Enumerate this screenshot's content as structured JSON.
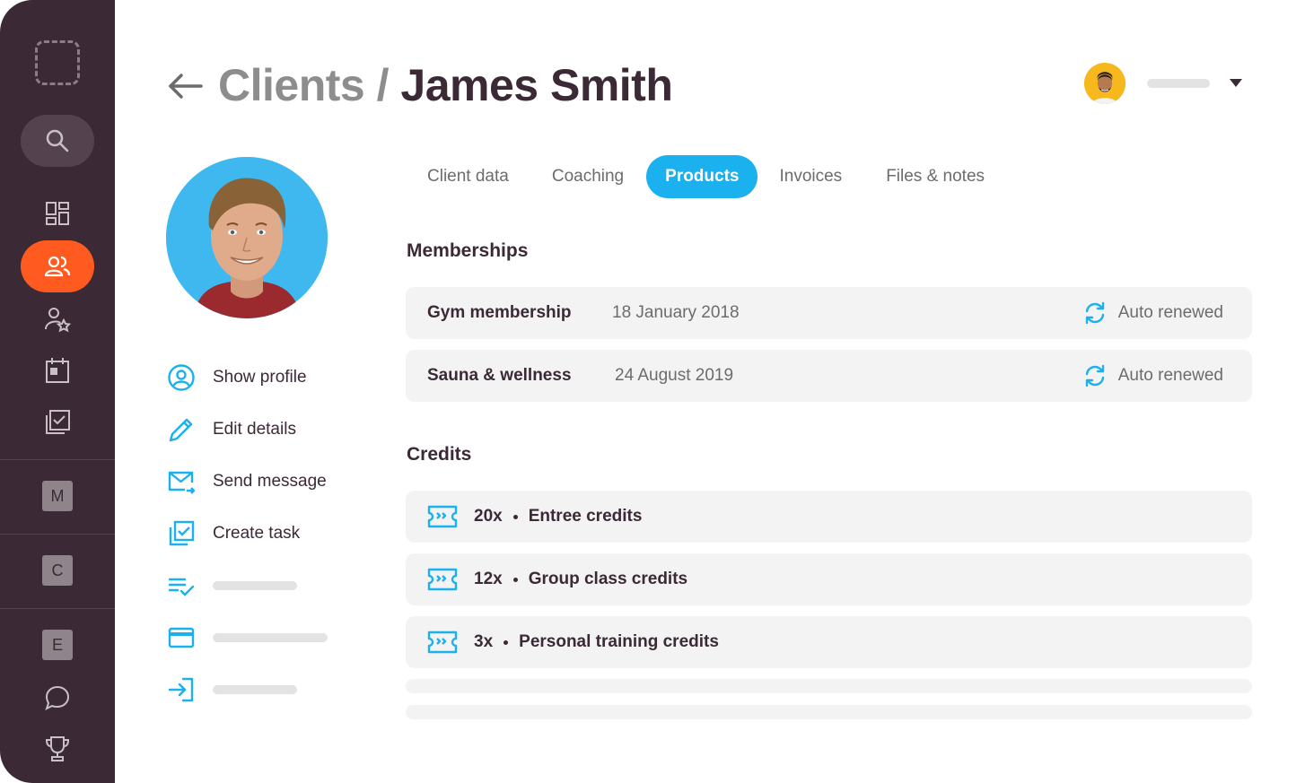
{
  "sidebar": {
    "icons": [
      "logo-placeholder-icon",
      "search-icon",
      "dashboard-icon",
      "clients-icon",
      "user-star-icon",
      "calendar-icon",
      "tasks-icon",
      "chat-icon",
      "trophy-icon"
    ],
    "letters": [
      "M",
      "C",
      "E"
    ],
    "active_color": "#ff5a1f",
    "background_color": "#3b2a36"
  },
  "header": {
    "breadcrumb": "Clients",
    "separator": " / ",
    "client_name": "James Smith"
  },
  "tabs": [
    {
      "label": "Client data",
      "active": false
    },
    {
      "label": "Coaching",
      "active": false
    },
    {
      "label": "Products",
      "active": true
    },
    {
      "label": "Invoices",
      "active": false
    },
    {
      "label": "Files & notes",
      "active": false
    }
  ],
  "actions": [
    {
      "label": "Show profile",
      "icon": "user-circle-icon"
    },
    {
      "label": "Edit details",
      "icon": "pencil-icon"
    },
    {
      "label": "Send message",
      "icon": "mail-send-icon"
    },
    {
      "label": "Create task",
      "icon": "task-check-icon"
    }
  ],
  "memberships": {
    "title": "Memberships",
    "items": [
      {
        "name": "Gym membership",
        "date": "18 January 2018",
        "status": "Auto renewed"
      },
      {
        "name": "Sauna & wellness",
        "date": "24 August 2019",
        "status": "Auto renewed"
      }
    ]
  },
  "credits": {
    "title": "Credits",
    "items": [
      {
        "count": "20x",
        "name": "Entree credits"
      },
      {
        "count": "12x",
        "name": "Group class credits"
      },
      {
        "count": "3x",
        "name": "Personal training credits"
      }
    ]
  },
  "accent_color": "#1bb0ee"
}
